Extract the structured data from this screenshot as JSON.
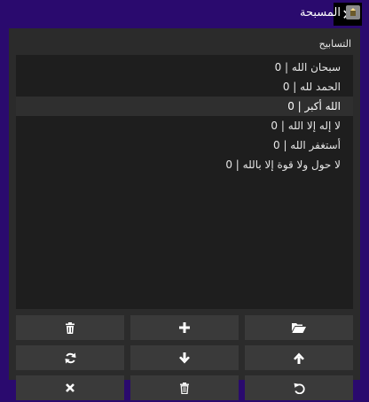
{
  "window": {
    "title": "المسبحة",
    "close_glyph": "✕"
  },
  "list_label": "التسابيح",
  "adhkar": [
    {
      "text": "سبحان الله",
      "count": "0"
    },
    {
      "text": "الحمد لله",
      "count": "0"
    },
    {
      "text": "الله أكبر",
      "count": "0",
      "selected": true
    },
    {
      "text": "لا إله إلا الله",
      "count": "0"
    },
    {
      "text": "أستغفر الله",
      "count": "0"
    },
    {
      "text": "لا حول ولا قوة إلا بالله",
      "count": "0"
    }
  ],
  "buttons": [
    {
      "row": 0,
      "col": 0,
      "icon": "trash-icon"
    },
    {
      "row": 0,
      "col": 1,
      "icon": "plus-icon"
    },
    {
      "row": 0,
      "col": 2,
      "icon": "folder-open-icon"
    },
    {
      "row": 1,
      "col": 0,
      "icon": "refresh-icon"
    },
    {
      "row": 1,
      "col": 1,
      "icon": "arrow-down-icon"
    },
    {
      "row": 1,
      "col": 2,
      "icon": "arrow-up-icon"
    },
    {
      "row": 2,
      "col": 0,
      "icon": "x-icon"
    },
    {
      "row": 2,
      "col": 1,
      "icon": "trash-outline-icon"
    },
    {
      "row": 2,
      "col": 2,
      "icon": "undo-icon"
    }
  ],
  "colors": {
    "frame": "#2a0a6e",
    "panel": "#2b2b2b",
    "list_bg": "#1e1e1e",
    "button_bg": "#3a3a3a"
  }
}
